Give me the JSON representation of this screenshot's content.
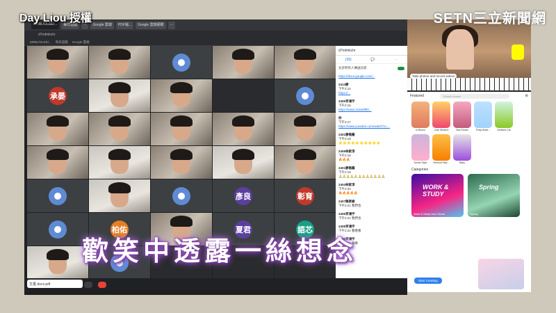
{
  "watermark": {
    "credit": "Day Liou 授權",
    "channel_logo": "SETN三立新聞網"
  },
  "browser": {
    "tabs": [
      "MRBL/OLEE/...",
      "每日遊戲",
      "...",
      "Google 雲端",
      "PDF檔...",
      "Google 雲端硬碟",
      "..."
    ],
    "meet_code": "d7ndmkchr",
    "file_chip": "文書.docx.pdf"
  },
  "grid": {
    "tiles": [
      {
        "type": "video",
        "name": ""
      },
      {
        "type": "video",
        "name": ""
      },
      {
        "type": "avatar-person",
        "name": ""
      },
      {
        "type": "video",
        "name": ""
      },
      {
        "type": "video",
        "name": ""
      },
      {
        "type": "avatar-text",
        "label": "承晏",
        "color": "#c0392b",
        "name": ""
      },
      {
        "type": "video2",
        "name": ""
      },
      {
        "type": "video",
        "name": ""
      },
      {
        "type": "dark",
        "name": ""
      },
      {
        "type": "avatar-person",
        "name": ""
      },
      {
        "type": "video",
        "name": ""
      },
      {
        "type": "video",
        "name": ""
      },
      {
        "type": "video",
        "name": ""
      },
      {
        "type": "video",
        "name": ""
      },
      {
        "type": "video",
        "name": ""
      },
      {
        "type": "video",
        "name": ""
      },
      {
        "type": "video2",
        "name": ""
      },
      {
        "type": "video",
        "name": ""
      },
      {
        "type": "video2",
        "name": ""
      },
      {
        "type": "video",
        "name": ""
      },
      {
        "type": "avatar-person",
        "name": ""
      },
      {
        "type": "video2",
        "name": ""
      },
      {
        "type": "avatar-person",
        "name": ""
      },
      {
        "type": "avatar-text",
        "label": "彥良",
        "color": "#5b3f9e",
        "name": ""
      },
      {
        "type": "avatar-text",
        "label": "彰育",
        "color": "#c0392b",
        "name": ""
      },
      {
        "type": "avatar-person",
        "name": ""
      },
      {
        "type": "avatar-text",
        "label": "柏佑",
        "color": "#e67e22",
        "name": ""
      },
      {
        "type": "video",
        "name": ""
      },
      {
        "type": "avatar-text",
        "label": "夏君",
        "color": "#5b3f9e",
        "name": ""
      },
      {
        "type": "avatar-text",
        "label": "語芯",
        "color": "#16a085",
        "name": ""
      },
      {
        "type": "video2",
        "name": ""
      },
      {
        "type": "avatar-person",
        "name": ""
      },
      {
        "type": "dark",
        "name": ""
      },
      {
        "type": "dark",
        "name": ""
      },
      {
        "type": "dark",
        "name": ""
      }
    ]
  },
  "chat": {
    "header": "d7ndmkchr",
    "tabs": [
      "(39)",
      "💬",
      "⋯"
    ],
    "toggle_label": "允許所有人傳送訊息",
    "messages": [
      {
        "who": "",
        "text": "",
        "link": "https://docs.google.com/..."
      },
      {
        "who": "2413廖",
        "text": "下午2:14",
        "link": "https://..."
      },
      {
        "who": "2406李鴻宇",
        "text": "下午2:16",
        "link": "https://www.4x3e6f9l0..."
      },
      {
        "who": "你",
        "text": "下午2:17",
        "link": "https://www.youtube.com/watch?v=..."
      },
      {
        "who": "2401廖楷蓁",
        "text": "下午2:18",
        "emoji": "🌟🌟🌟🌟🌟🌟🌟🌟🌟🌟"
      },
      {
        "who": "2408林家淳",
        "text": "下午2:19",
        "warn": "🔥🔥🔥"
      },
      {
        "who": "2401廖楷蓁",
        "text": "下午2:19",
        "warn": "🙏🙏🙏🙏🙏🙏🙏🙏🙏🙏🙏🙏"
      },
      {
        "who": "2404林家淳",
        "text": "下午2:20",
        "hot": "🔥🔥🔥🔥🔥"
      },
      {
        "who": "2407陳彥綾",
        "text": "下午2:21 我們也"
      },
      {
        "who": "2406李鴻宇",
        "text": "下午2:21 我們也"
      },
      {
        "who": "2408李鴻宇",
        "text": "下午2:22 看看看"
      },
      {
        "who": "2406李鴻宇",
        "text": "下午2:22 蘋果"
      }
    ]
  },
  "right_panel": {
    "capture_hint": "Take photos and record videos",
    "featured_title": "Featured",
    "search_placeholder": "Search lenses",
    "lenses_row1": [
      "In Bloom",
      "Cute Stickers",
      "Sea Flower",
      "Pinky Butte...",
      "Sentient Cat"
    ],
    "lenses_row2": [
      "Anime Style",
      "Remove Bac...",
      "Baby"
    ],
    "categories_title": "Categories",
    "category_1": "Work & Study from Home",
    "category_1_word": "WORK & STUDY",
    "category_2": "Spring",
    "category_2_word": "Spring",
    "start_button": "Start Creating"
  },
  "caption": "歡笑中透露一絲想念",
  "colors": {
    "meet_dark": "#202124",
    "google_blue": "#1a73e8",
    "caption_glow": "#8e44ad"
  }
}
